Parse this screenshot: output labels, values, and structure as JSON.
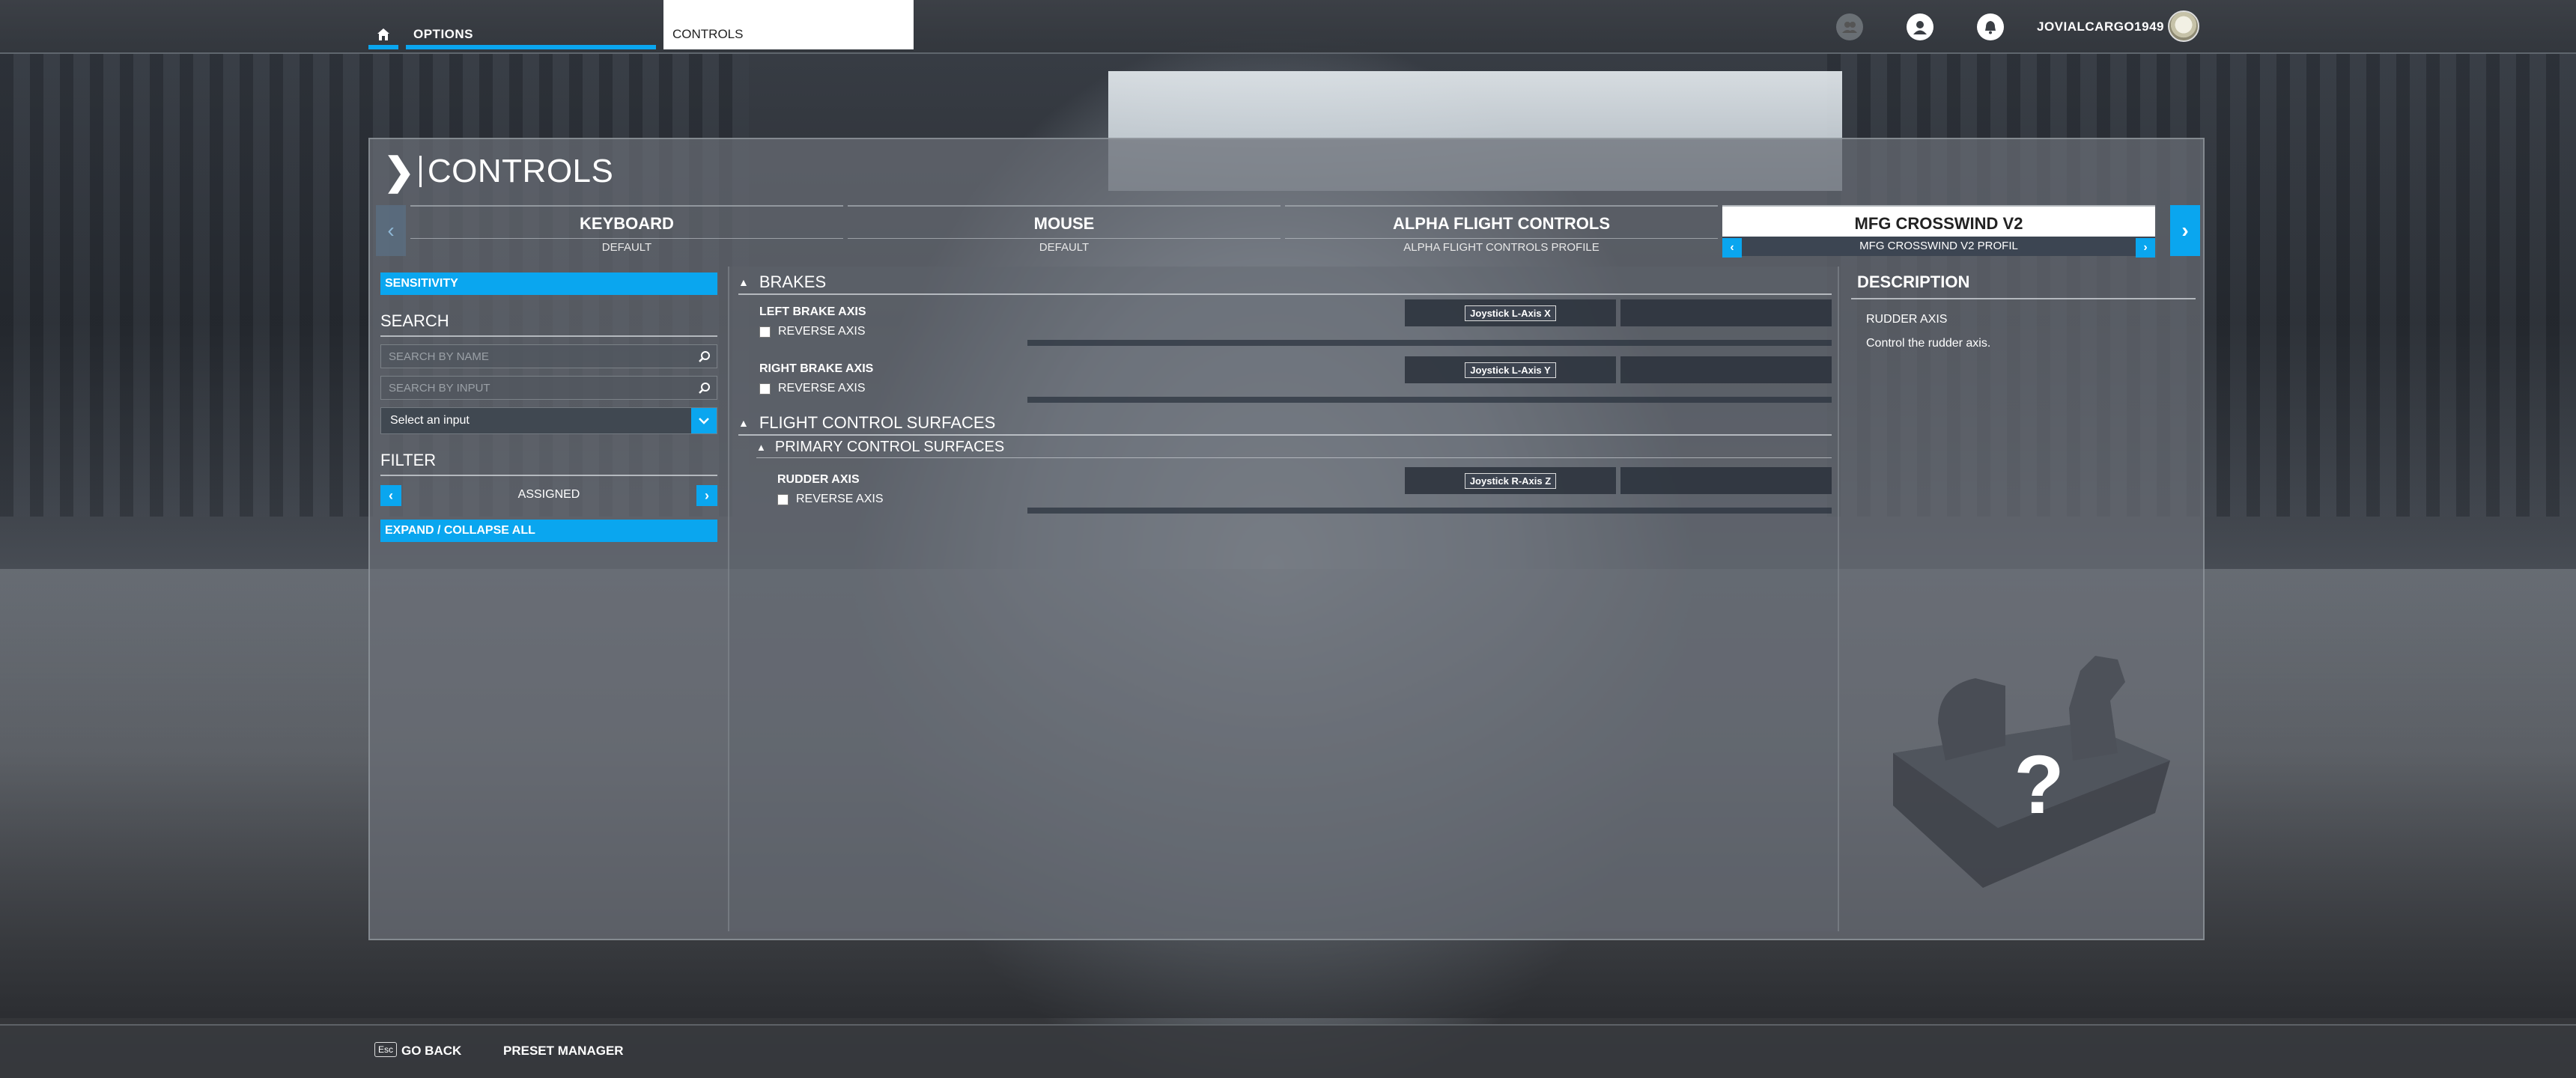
{
  "topbar": {
    "options_label": "OPTIONS",
    "controls_label": "CONTROLS",
    "username": "JOVIALCARGO1949"
  },
  "panel": {
    "title": "CONTROLS",
    "profiles": [
      {
        "name": "KEYBOARD",
        "preset": "DEFAULT"
      },
      {
        "name": "MOUSE",
        "preset": "DEFAULT"
      },
      {
        "name": "ALPHA FLIGHT CONTROLS",
        "preset": "ALPHA FLIGHT CONTROLS PROFILE"
      },
      {
        "name": "MFG CROSSWIND V2",
        "preset": "MFG CROSSWIND V2 PROFIL"
      }
    ]
  },
  "left": {
    "sensitivity_label": "SENSITIVITY",
    "search_title": "SEARCH",
    "search_by_name_placeholder": "SEARCH BY NAME",
    "search_by_input_placeholder": "SEARCH BY INPUT",
    "select_input_value": "Select an input",
    "filter_title": "FILTER",
    "filter_value": "ASSIGNED",
    "expand_collapse_label": "EXPAND / COLLAPSE ALL"
  },
  "bindings": {
    "brakes_category": "BRAKES",
    "left_brake": {
      "name": "LEFT BRAKE AXIS",
      "reverse": "REVERSE AXIS",
      "input": "Joystick L-Axis X"
    },
    "right_brake": {
      "name": "RIGHT BRAKE AXIS",
      "reverse": "REVERSE AXIS",
      "input": "Joystick L-Axis Y"
    },
    "flight_category": "FLIGHT CONTROL SURFACES",
    "primary_subcategory": "PRIMARY CONTROL SURFACES",
    "rudder": {
      "name": "RUDDER AXIS",
      "reverse": "REVERSE AXIS",
      "input": "Joystick R-Axis Z"
    }
  },
  "description": {
    "title": "DESCRIPTION",
    "name": "RUDDER AXIS",
    "text": "Control the rudder axis.",
    "illustration_symbol": "?"
  },
  "bottombar": {
    "esc_key": "Esc",
    "go_back": "GO BACK",
    "preset_manager": "PRESET MANAGER"
  },
  "colors": {
    "accent": "#0aa6ef",
    "panel": "#696e76",
    "active_tab": "#ffffff"
  },
  "icons": [
    "home-icon",
    "friends-icon",
    "profile-icon",
    "notifications-icon",
    "search-icon",
    "chevron-down-icon",
    "chevron-left-icon",
    "chevron-right-icon",
    "caret-up-icon"
  ]
}
